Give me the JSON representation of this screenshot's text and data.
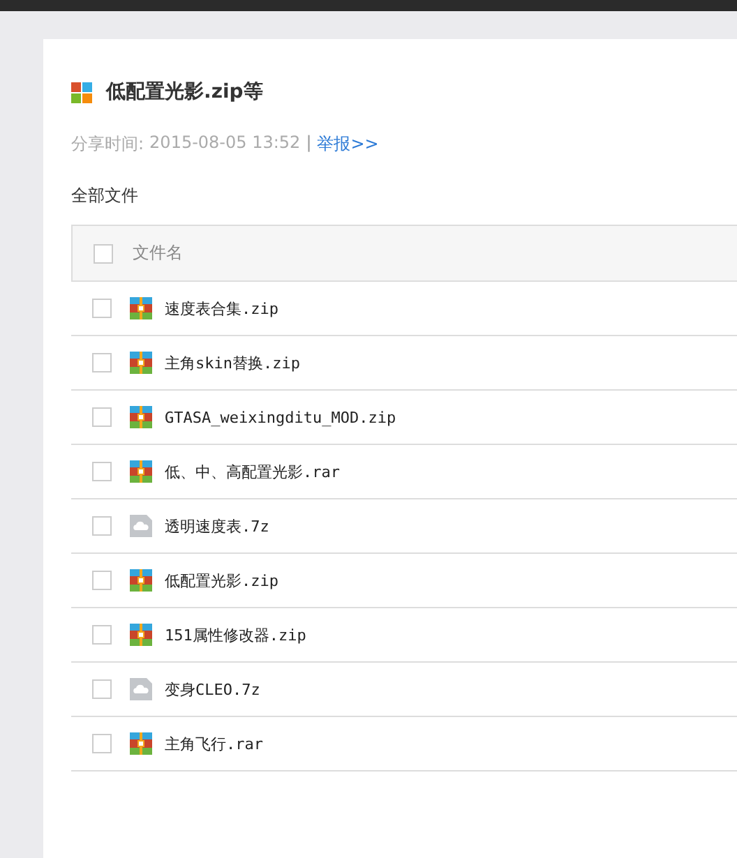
{
  "share": {
    "title": "低配置光影.zip等",
    "time_label": "分享时间:",
    "time": "2015-08-05 13:52",
    "separator": "|",
    "report_link": "举报>>"
  },
  "section_title": "全部文件",
  "table": {
    "header": {
      "label": "文件名",
      "checked": false
    },
    "rows": [
      {
        "name": "速度表合集.zip",
        "kind": "archive",
        "checked": false
      },
      {
        "name": "主角skin替换.zip",
        "kind": "archive",
        "checked": false
      },
      {
        "name": "GTASA_weixingditu_MOD.zip",
        "kind": "archive",
        "checked": false
      },
      {
        "name": "低、中、高配置光影.rar",
        "kind": "archive",
        "checked": false
      },
      {
        "name": "透明速度表.7z",
        "kind": "unknown",
        "checked": false
      },
      {
        "name": "低配置光影.zip",
        "kind": "archive",
        "checked": false
      },
      {
        "name": "151属性修改器.zip",
        "kind": "archive",
        "checked": false
      },
      {
        "name": "变身CLEO.7z",
        "kind": "unknown",
        "checked": false
      },
      {
        "name": "主角飞行.rar",
        "kind": "archive",
        "checked": false
      }
    ]
  }
}
